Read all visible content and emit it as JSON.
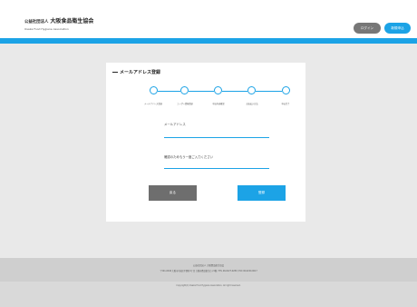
{
  "header": {
    "org_type": "公益社団法人",
    "org_name": "大阪食品衛生協会",
    "org_english": "Osaka Food Hygiene Association",
    "login_label": "ログイン",
    "register_label": "新規申込"
  },
  "colors": {
    "accent": "#1ca3e6",
    "back_button": "#6e6e6e",
    "login_button": "#777777"
  },
  "form": {
    "title": "メールアドレス登録",
    "steps": [
      {
        "label": "メールアドレス登録"
      },
      {
        "label": "ユーザー情報登録"
      },
      {
        "label": "申込内容確認"
      },
      {
        "label": "お支払い方法"
      },
      {
        "label": "申込完了"
      }
    ],
    "email_label": "メールアドレス",
    "email_value": "",
    "confirm_label": "確認のためもう一度ご入力ください",
    "confirm_value": "",
    "back_label": "戻る",
    "next_label": "登録"
  },
  "footer": {
    "line1": "公益社団法人 大阪食品衛生協会",
    "line2": "〒541-0046 大阪市中央区平野町4丁目 大阪府食品衛生ビル5階 / TEL 06-6227-0280 / FAX 06-6220-0617",
    "copyright": "Copyright(C) Osaka Food Hygiene Association, All right reserved."
  }
}
